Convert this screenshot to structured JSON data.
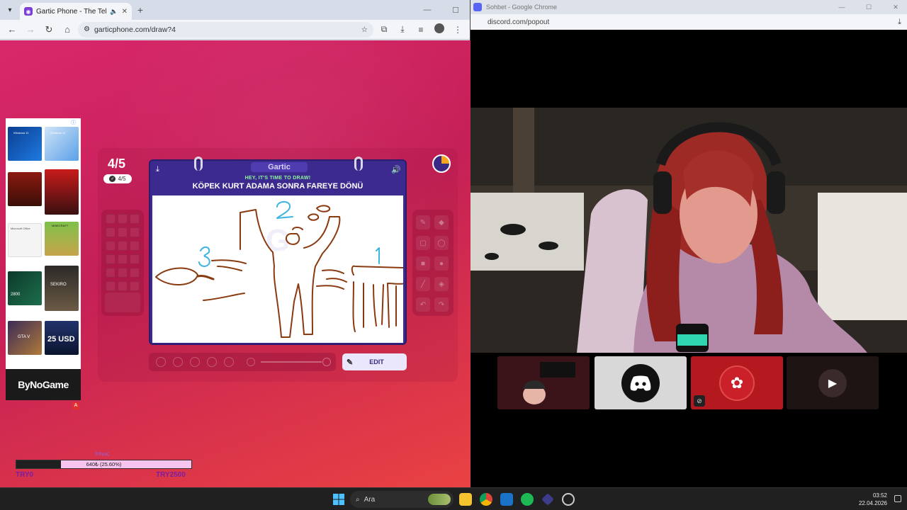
{
  "left_window": {
    "tab_title": "Gartic Phone - The Telephone Game",
    "url": "garticphone.com/draw?4"
  },
  "game": {
    "round_big": "4/5",
    "round_small": "4/5",
    "card_brand": "Gartic",
    "card_subtitle": "HEY, IT'S TIME TO DRAW!",
    "prompt": "KÖPEK KURT ADAMA SONRA FAREYE DÖNÜ",
    "edit_label": "EDIT"
  },
  "ad": {
    "tile_labels": [
      "Windows 11",
      "Windows 11",
      "Microsoft Office",
      "MINECRAFT",
      "2800",
      "SEKIRO",
      "GTA V",
      "25 USD"
    ],
    "footer": "ByNoGame",
    "badge": "A"
  },
  "donation_goal": {
    "title": "İhtiyaç",
    "progress_text": "640₺ (25.60%)",
    "progress_fraction": 0.256,
    "min": "TRY0",
    "max": "TRY2500"
  },
  "right_window": {
    "title": "Sohbet - Google Chrome",
    "url": "discord.com/popout"
  },
  "taskbar": {
    "search_placeholder": "Ara",
    "time": "03:52",
    "date": "22.04.2026"
  },
  "colors": {
    "game_bg": "#d8286a",
    "card_bg": "#3c2a8e",
    "sketch_brown": "#8a3a10",
    "sketch_blue": "#3fb4e0"
  }
}
